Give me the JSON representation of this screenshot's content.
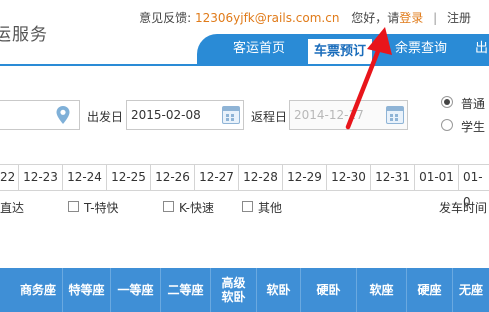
{
  "site_title": "运服务",
  "topbar": {
    "feedback_label": "意见反馈:",
    "feedback_email": "12306yjfk@rails.com.cn",
    "greeting": "您好，请",
    "login": "登录",
    "separator": "|",
    "register": "注册"
  },
  "nav": {
    "items": [
      "客运首页",
      "车票预订",
      "余票查询",
      "出"
    ],
    "active_index": 1
  },
  "search": {
    "depart_label": "出发日",
    "depart_date": "2015-02-08",
    "return_label": "返程日",
    "return_date": "2014-12-17",
    "ticket_types": [
      "普通",
      "学生"
    ],
    "selected_type": "普通"
  },
  "date_tabs": [
    "22",
    "12-23",
    "12-24",
    "12-25",
    "12-26",
    "12-27",
    "12-28",
    "12-29",
    "12-30",
    "12-31",
    "01-01",
    "01-0"
  ],
  "filters": {
    "items": [
      "直达",
      "T-特快",
      "K-快速",
      "其他"
    ],
    "depart_time_label": "发车时间"
  },
  "table_header": [
    "商务座",
    "特等座",
    "一等座",
    "二等座",
    "高级软卧",
    "软卧",
    "硬卧",
    "软座",
    "硬座",
    "无座"
  ],
  "colors": {
    "nav_blue": "#2a8bd6",
    "header_blue": "#3f8fd6",
    "link_orange": "#e07b1a",
    "arrow_red": "#e8151b"
  }
}
